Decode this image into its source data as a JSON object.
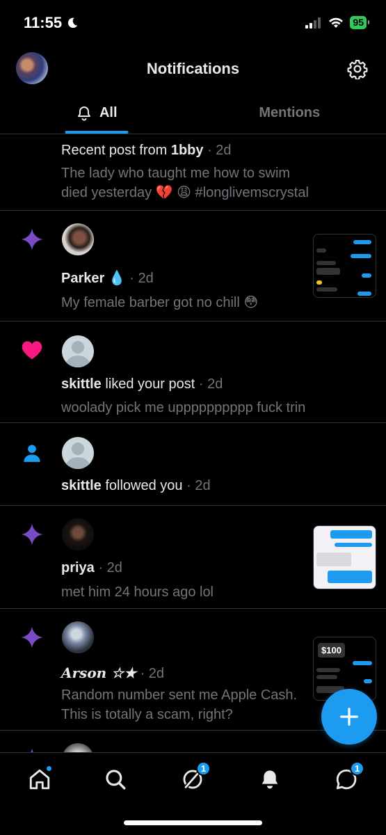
{
  "status_bar": {
    "time": "11:55",
    "battery": "95"
  },
  "header": {
    "title": "Notifications"
  },
  "tabs": [
    {
      "label": "All"
    },
    {
      "label": "Mentions"
    }
  ],
  "notifications": [
    {
      "type": "post",
      "prefix": "Recent post from ",
      "user": "1bby",
      "time": "· 2d",
      "text": "The lady who taught me how to swim died yesterday 💔 😩 #longlivemscrystal"
    },
    {
      "type": "star",
      "user": "Parker 💧",
      "time": "· 2d",
      "text": "My female barber got no chill 😳"
    },
    {
      "type": "like",
      "user": "skittle",
      "action": " liked your post",
      "time": "· 2d",
      "text": "woolady pick me upppppppppp fuck trin"
    },
    {
      "type": "follow",
      "user": "skittle",
      "action": " followed you",
      "time": "· 2d"
    },
    {
      "type": "star",
      "user": "priya",
      "time": "· 2d",
      "text": "met him 24 hours ago lol"
    },
    {
      "type": "star",
      "user": "𝑨𝒓𝒔𝒐𝒏 ☆★",
      "time": "· 2d",
      "text": "Random number sent me Apple Cash. This is totally a scam, right?",
      "thumb_amount": "$100"
    }
  ],
  "bottom_nav": {
    "grok_badge": "1",
    "messages_badge": "1"
  },
  "colors": {
    "accent": "#1d9bf0",
    "star": "#794bc4",
    "like": "#f91880",
    "muted": "#71767b"
  }
}
